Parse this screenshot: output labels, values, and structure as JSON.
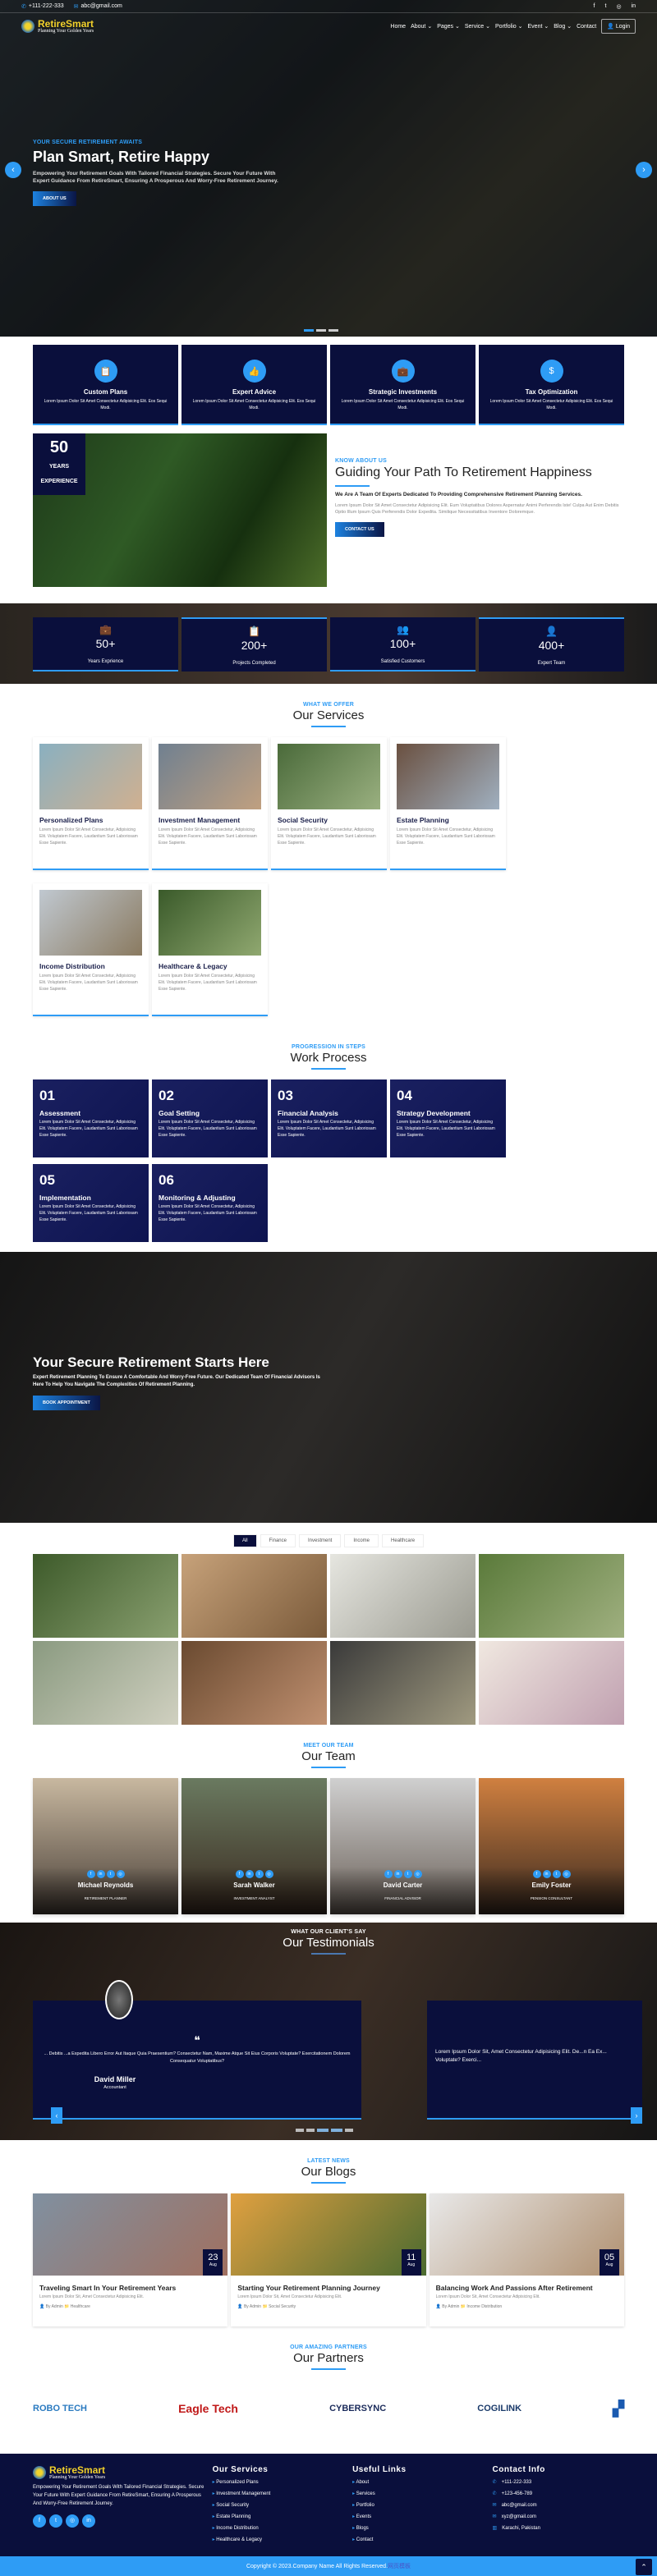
{
  "colors": {
    "accent": "#2e9cf5",
    "navy": "#0a0f3c",
    "logo": "#f2d12a"
  },
  "topbar": {
    "phone": "+111-222-333",
    "email": "abc@gmail.com",
    "social": [
      "facebook-icon",
      "twitter-icon",
      "instagram-icon",
      "linkedin-icon"
    ]
  },
  "brand": {
    "name": "RetireSmart",
    "tagline": "Planning Your Golden Years"
  },
  "nav": {
    "items": [
      "Home",
      "About",
      "Pages",
      "Service",
      "Portfolio",
      "Event",
      "Blog",
      "Contact"
    ],
    "login": "Login"
  },
  "hero": {
    "kicker": "YOUR SECURE RETIREMENT AWAITS",
    "title": "Plan Smart, Retire Happy",
    "text": "Empowering Your Retirement Goals With Tailored Financial Strategies. Secure Your Future With Expert Guidance From RetireSmart, Ensuring A Prosperous And Worry-Free Retirement Journey.",
    "button": "ABOUT US"
  },
  "features": [
    {
      "title": "Custom Plans",
      "text": "Lorem Ipsum Dolor Sit Amet Consectetur Adipisicing Elit. Eos Sequi Modi.",
      "icon": "clipboard-icon"
    },
    {
      "title": "Expert Advice",
      "text": "Lorem Ipsum Dolor Sit Amet Consectetur Adipisicing Elit. Eos Sequi Modi.",
      "icon": "thumbs-up-icon"
    },
    {
      "title": "Strategic Investments",
      "text": "Lorem Ipsum Dolor Sit Amet Consectetur Adipisicing Elit. Eos Sequi Modi.",
      "icon": "briefcase-icon"
    },
    {
      "title": "Tax Optimization",
      "text": "Lorem Ipsum Dolor Sit Amet Consectetur Adipisicing Elit. Eos Sequi Modi.",
      "icon": "money-bag-icon"
    }
  ],
  "about": {
    "badge_num": "50",
    "badge_text": "YEARS EXPERIENCE",
    "kicker": "KNOW ABOUT US",
    "title": "Guiding Your Path To Retirement Happiness",
    "lead": "We Are A Team Of Experts Dedicated To Providing Comprehensive Retirement Planning Services.",
    "text": "Lorem Ipsum Dolor Sit Amet Consectetur Adipisicing Elit. Eum Voluptatibus Dolores Aspernatur Animi Perferendis Iste! Culpa Aut Enim Debitis Optio Illum Ipsum Quis Perferendis Dolor Expedita. Similique Necessitatibus Inventore Doloremque.",
    "button": "CONTACT US"
  },
  "stats": [
    {
      "value": "50+",
      "label": "Years Exprience",
      "icon": "briefcase-icon"
    },
    {
      "value": "200+",
      "label": "Projects Completed",
      "icon": "clipboard-list-icon"
    },
    {
      "value": "100+",
      "label": "Satisfied Customers",
      "icon": "users-icon"
    },
    {
      "value": "400+",
      "label": "Expert Team",
      "icon": "user-gear-icon"
    }
  ],
  "services": {
    "kicker": "WHAT WE OFFER",
    "title": "Our Services",
    "items": [
      {
        "title": "Personalized Plans",
        "text": "Lorem Ipsum Dolor Sit Amet Consectetur, Adipisicing Elit. Voluptatem Facere, Laudantium Sunt Laboriosam Esse Sapiente."
      },
      {
        "title": "Investment Management",
        "text": "Lorem Ipsum Dolor Sit Amet Consectetur, Adipisicing Elit. Voluptatem Facere, Laudantium Sunt Laboriosam Esse Sapiente."
      },
      {
        "title": "Social Security",
        "text": "Lorem Ipsum Dolor Sit Amet Consectetur, Adipisicing Elit. Voluptatem Facere, Laudantium Sunt Laboriosam Esse Sapiente."
      },
      {
        "title": "Estate Planning",
        "text": "Lorem Ipsum Dolor Sit Amet Consectetur, Adipisicing Elit. Voluptatem Facere, Laudantium Sunt Laboriosam Esse Sapiente."
      },
      {
        "title": "Income Distribution",
        "text": "Lorem Ipsum Dolor Sit Amet Consectetur, Adipisicing Elit. Voluptatem Facere, Laudantium Sunt Laboriosam Esse Sapiente."
      },
      {
        "title": "Healthcare & Legacy",
        "text": "Lorem Ipsum Dolor Sit Amet Consectetur, Adipisicing Elit. Voluptatem Facere, Laudantium Sunt Laboriosam Esse Sapiente."
      }
    ]
  },
  "process": {
    "kicker": "PROGRESSION IN STEPS",
    "title": "Work Process",
    "steps": [
      {
        "num": "01",
        "title": "Assessment",
        "text": "Lorem Ipsum Dolor Sit Amet Consectetur, Adipisicing Elit. Voluptatem Facere, Laudantium Sunt Laboriosam Esse Sapiente."
      },
      {
        "num": "02",
        "title": "Goal Setting",
        "text": "Lorem Ipsum Dolor Sit Amet Consectetur, Adipisicing Elit. Voluptatem Facere, Laudantium Sunt Laboriosam Esse Sapiente."
      },
      {
        "num": "03",
        "title": "Financial Analysis",
        "text": "Lorem Ipsum Dolor Sit Amet Consectetur, Adipisicing Elit. Voluptatem Facere, Laudantium Sunt Laboriosam Esse Sapiente."
      },
      {
        "num": "04",
        "title": "Strategy Development",
        "text": "Lorem Ipsum Dolor Sit Amet Consectetur, Adipisicing Elit. Voluptatem Facere, Laudantium Sunt Laboriosam Esse Sapiente."
      },
      {
        "num": "05",
        "title": "Implementation",
        "text": "Lorem Ipsum Dolor Sit Amet Consectetur, Adipisicing Elit. Voluptatem Facere, Laudantium Sunt Laboriosam Esse Sapiente."
      },
      {
        "num": "06",
        "title": "Monitoring & Adjusting",
        "text": "Lorem Ipsum Dolor Sit Amet Consectetur, Adipisicing Elit. Voluptatem Facere, Laudantium Sunt Laboriosam Esse Sapiente."
      }
    ]
  },
  "cta": {
    "title": "Your Secure Retirement Starts Here",
    "text": "Expert Retirement Planning To Ensure A Comfortable And Worry-Free Future. Our Dedicated Team Of Financial Advisors Is Here To Help You Navigate The Complexities Of Retirement Planning.",
    "button": "BOOK APPOINTMENT"
  },
  "portfolio": {
    "tabs": [
      "All",
      "Finance",
      "Investment",
      "Income",
      "Healthcare"
    ],
    "active": "All"
  },
  "team": {
    "kicker": "MEET OUR TEAM",
    "title": "Our Team",
    "members": [
      {
        "name": "Michael Reynolds",
        "role": "RETIREMENT PLANNER"
      },
      {
        "name": "Sarah Walker",
        "role": "INVESTMENT ANALYST"
      },
      {
        "name": "David Carter",
        "role": "FINANCIAL ADVISOR"
      },
      {
        "name": "Emily Foster",
        "role": "PENSION CONSULTANT"
      }
    ]
  },
  "testimonials": {
    "kicker": "WHAT OUR CLIENT'S SAY",
    "title": "Our Testimonials",
    "items": [
      {
        "text": "... Debitis ...a Expedita Libero Error Aut Itaque Quia Praesentium? Consectetur Nam, Maxime Atque Sit Eius Corporis Voluptate? Exercitationem Dolorem Consequatur Voluptatibus?",
        "name": "David Miller",
        "role": "Accountant"
      },
      {
        "text": "Lorem Ipsum Dolor Sit, Amet Consectetur Adipisicing Elit. De...n Ea Ex... Voluptate? Exerci..."
      }
    ]
  },
  "blogs": {
    "kicker": "LATEST NEWS",
    "title": "Our Blogs",
    "items": [
      {
        "day": "23",
        "month": "Aug",
        "title": "Traveling Smart In Your Retirement Years",
        "text": "Lorem Ipsum Dolor Sit, Amet Consectetur Adipisicing Elit.",
        "author": "By Admin",
        "category": "Healthcare"
      },
      {
        "day": "11",
        "month": "Aug",
        "title": "Starting Your Retirement Planning Journey",
        "text": "Lorem Ipsum Dolor Sit, Amet Consectetur Adipisicing Elit.",
        "author": "By Admin",
        "category": "Social Security"
      },
      {
        "day": "05",
        "month": "Aug",
        "title": "Balancing Work And Passions After Retirement",
        "text": "Lorem Ipsum Dolor Sit, Amet Consectetur Adipisicing Elit.",
        "author": "By Admin",
        "category": "Income Distribution"
      }
    ]
  },
  "partners": {
    "kicker": "OUR AMAZING PARTNERS",
    "title": "Our Partners",
    "logos": [
      "ROBO TECH",
      "Eagle Tech",
      "CYBERSYNC",
      "COGILINK"
    ]
  },
  "footer": {
    "about": "Empowering Your Retirement Goals With Tailored Financial Strategies. Secure Your Future With Expert Guidance From RetireSmart, Ensuring A Prosperous And Worry-Free Retirement Journey.",
    "services_title": "Our Services",
    "services": [
      "Personalized Plans",
      "Investment Management",
      "Social Security",
      "Estate Planning",
      "Income Distribution",
      "Healthcare & Legacy"
    ],
    "links_title": "Useful Links",
    "links": [
      "About",
      "Services",
      "Portfolio",
      "Events",
      "Blogs",
      "Contact"
    ],
    "contact_title": "Contact Info",
    "contact": [
      "+111-222-333",
      "+123-456-789",
      "abc@gmail.com",
      "xyz@gmail.com",
      "Karachi, Pakistan"
    ],
    "copyright": "Copyright © 2023.Company Name All Rights Reserved.",
    "copyright_link": "网页模板"
  }
}
